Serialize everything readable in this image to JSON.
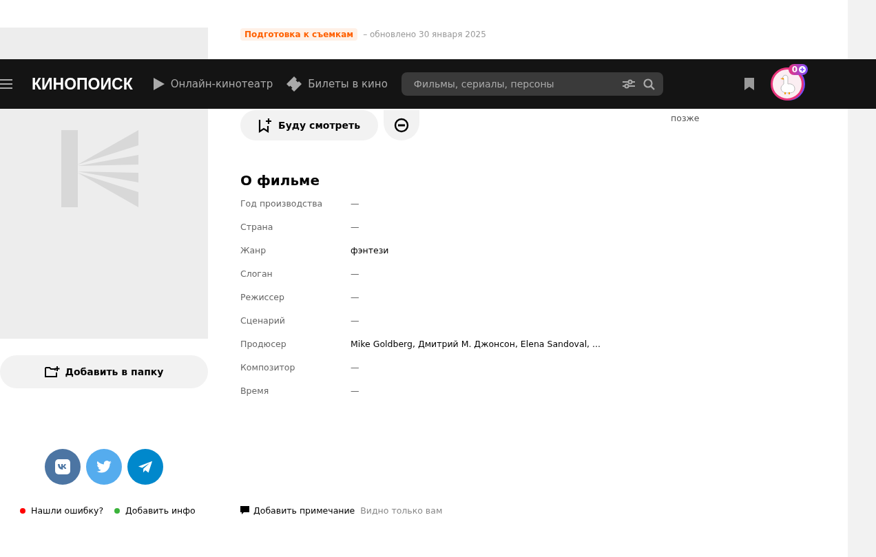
{
  "header": {
    "logo": "КИНОПОИСК",
    "nav": [
      {
        "label": "Онлайн-кинотеатр",
        "kind": "play"
      },
      {
        "label": "Билеты в кино",
        "kind": "ticket"
      }
    ],
    "search": {
      "placeholder": "Фильмы, сериалы, персоны"
    },
    "badge": "0"
  },
  "status": {
    "tag": "Подготовка к съемкам",
    "updated": "– обновлено 30 января 2025"
  },
  "actions": {
    "watch": "Буду смотреть"
  },
  "side_note": "позже",
  "folder_button": "Добавить в папку",
  "about": {
    "title": "О фильме",
    "rows": [
      {
        "label": "Год производства",
        "kind": "text",
        "value": "—"
      },
      {
        "label": "Страна",
        "kind": "text",
        "value": "—"
      },
      {
        "label": "Жанр",
        "kind": "link",
        "value": "фэнтези"
      },
      {
        "label": "Слоган",
        "kind": "text",
        "value": "—"
      },
      {
        "label": "Режиссер",
        "kind": "text",
        "value": "—"
      },
      {
        "label": "Сценарий",
        "kind": "text",
        "value": "—"
      },
      {
        "label": "Продюсер",
        "kind": "link",
        "value": "Mike Goldberg, Дмитрий М. Джонсон, Elena Sandoval, ..."
      },
      {
        "label": "Композитор",
        "kind": "text",
        "value": "—"
      },
      {
        "label": "Время",
        "kind": "text",
        "value": "—"
      }
    ]
  },
  "share": [
    {
      "kind": "vk",
      "color": "#4c75a3"
    },
    {
      "kind": "twitter",
      "color": "#55acee"
    },
    {
      "kind": "telegram",
      "color": "#0088cc"
    }
  ],
  "feedback": [
    {
      "label": "Нашли ошибку?",
      "color": "#ff0000"
    },
    {
      "label": "Добавить инфо",
      "color": "#3bb33b"
    }
  ],
  "note": {
    "label": "Добавить примечание",
    "hint": "Видно только вам"
  }
}
